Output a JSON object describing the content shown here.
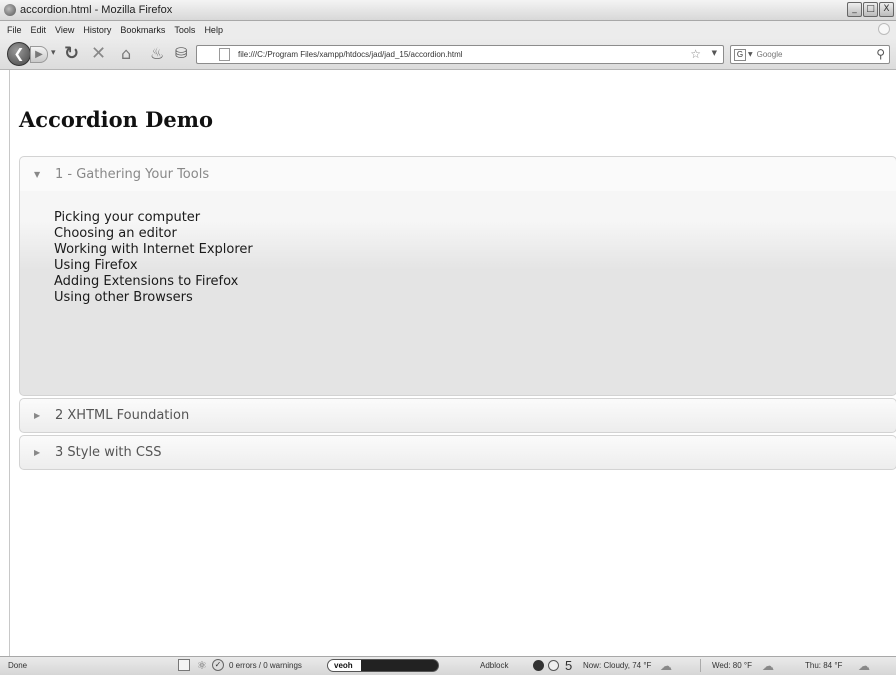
{
  "window": {
    "title": "accordion.html - Mozilla Firefox",
    "buttons": {
      "minimize": "_",
      "maximize": "□",
      "close": "X"
    }
  },
  "menu": [
    "File",
    "Edit",
    "View",
    "History",
    "Bookmarks",
    "Tools",
    "Help"
  ],
  "nav": {
    "url": "file:///C:/Program Files/xampp/htdocs/jad/jad_15/accordion.html",
    "search_engine": "G",
    "search_placeholder": "Google"
  },
  "page": {
    "title": "Accordion Demo",
    "accordion": [
      {
        "header": "1 - Gathering Your Tools",
        "expanded": true,
        "items": [
          "Picking your computer",
          "Choosing an editor",
          "Working with Internet Explorer",
          "Using Firefox",
          "Adding Extensions to Firefox",
          "Using other Browsers"
        ]
      },
      {
        "header": "2 XHTML Foundation",
        "expanded": false
      },
      {
        "header": "3 Style with CSS",
        "expanded": false
      }
    ]
  },
  "status": {
    "text": "Done",
    "errors": "0 errors / 0 warnings",
    "veoh": "veoh",
    "adblock": "Adblock",
    "count": "5",
    "weather_now": "Now: Cloudy, 74 °F",
    "weather_wed": "Wed: 80 °F",
    "weather_thu": "Thu: 84 °F"
  },
  "icons": {
    "back": "back-arrow-icon",
    "forward": "forward-arrow-icon",
    "reload": "reload-icon",
    "stop": "stop-icon",
    "home": "home-icon",
    "bookmark": "star-icon",
    "search": "magnifier-icon",
    "accordion_expanded": "triangle-down-icon",
    "accordion_collapsed": "triangle-right-icon"
  }
}
